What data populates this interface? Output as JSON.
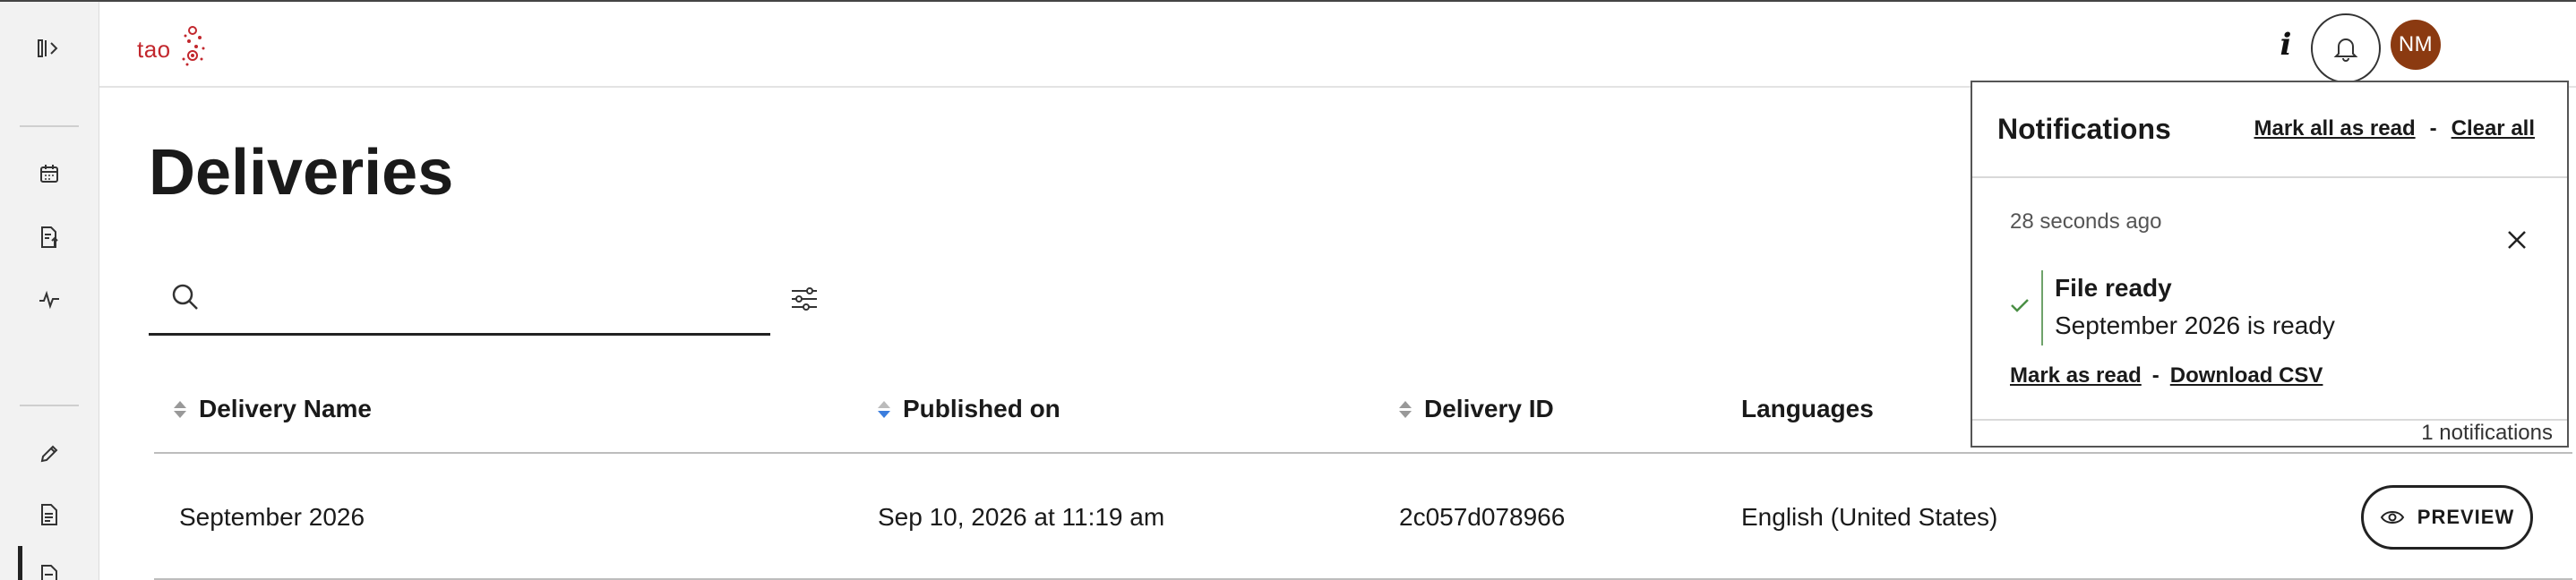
{
  "app": {
    "logo_text": "tao",
    "page_title": "Deliveries"
  },
  "header": {
    "info_label": "i",
    "avatar_initials": "NM",
    "avatar_color": "#8b3a11"
  },
  "sidebar": {
    "icons": [
      "collapse-sidebar-icon",
      "calendar-icon",
      "document-upload-icon",
      "activity-icon",
      "pencil-icon",
      "document-icon",
      "document-active-icon"
    ]
  },
  "search": {
    "value": "",
    "placeholder": ""
  },
  "table": {
    "columns": [
      {
        "label": "Delivery Name",
        "sortable": true,
        "sorted": false
      },
      {
        "label": "Published on",
        "sortable": true,
        "sorted": "desc"
      },
      {
        "label": "Delivery ID",
        "sortable": true,
        "sorted": false
      },
      {
        "label": "Languages",
        "sortable": false,
        "sorted": false
      }
    ],
    "rows": [
      {
        "name": "September 2026",
        "published": "Sep 10, 2026 at 11:19 am",
        "id": "2c057d078966",
        "languages": "English (United States)",
        "preview_label": "PREVIEW"
      }
    ]
  },
  "notifications": {
    "title": "Notifications",
    "mark_all_read": "Mark all as read",
    "separator": "-",
    "clear_all": "Clear all",
    "items": [
      {
        "time": "28 seconds ago",
        "title": "File ready",
        "text": "September 2026 is ready",
        "mark_read": "Mark as read",
        "download": "Download CSV",
        "status_color": "#4a8f45"
      }
    ],
    "count_text": "1 notifications"
  }
}
